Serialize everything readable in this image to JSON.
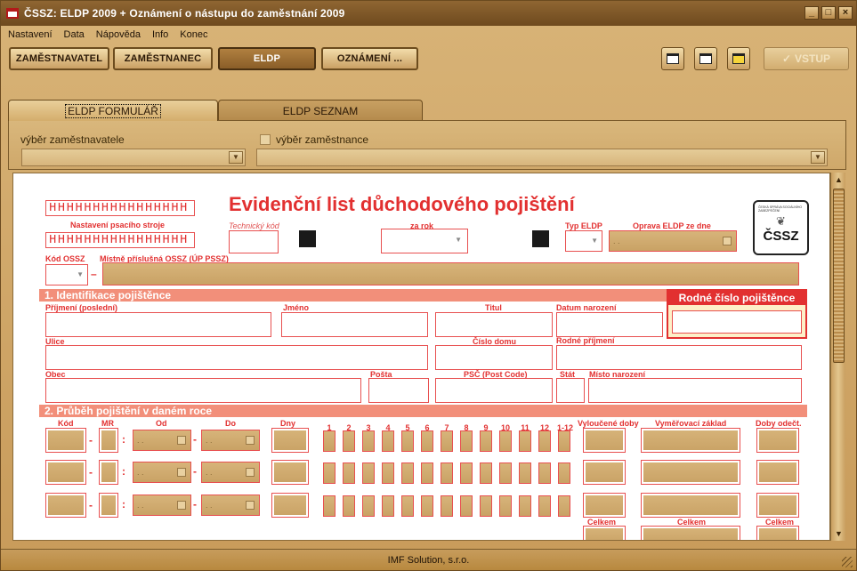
{
  "window": {
    "title": "ČSSZ: ELDP 2009 + Oznámení o nástupu do zaměstnání 2009",
    "minimize": "_",
    "maximize": "□",
    "close": "×"
  },
  "menu": [
    "Nastavení",
    "Data",
    "Nápověda",
    "Info",
    "Konec"
  ],
  "toolbar": {
    "zamestnavatel": "ZAMĚSTNAVATEL",
    "zamestnanec": "ZAMĚSTNANEC",
    "eldp": "ELDP",
    "oznameni": "OZNÁMENÍ ...",
    "vstup": "VSTUP"
  },
  "tabs": {
    "form": "ELDP FORMULÁŘ",
    "list": "ELDP SEZNAM"
  },
  "selectors": {
    "employer_label": "výběr zaměstnavatele",
    "employee_label": "výběr zaměstnance"
  },
  "form": {
    "title": "Evidenční list důchodového pojištění",
    "hatch_text": "HHHHHHHHHHHHHHHH",
    "typewriter_label": "Nastavení psacího stroje",
    "tech_code_label": "Technický kód",
    "year_label": "za rok",
    "eldp_type_label": "Typ ELDP",
    "correction_label": "Oprava ELDP ze dne",
    "date_placeholder": ". .",
    "ossz_code_label": "Kód OSSZ",
    "ossz_local_label": "Místně příslušná OSSZ (ÚP PSSZ)",
    "logo_small": "ČESKÁ SPRÁVA SOCIÁLNÍHO ZABEZPEČENÍ",
    "logo_text": "ČSSZ",
    "section1": "1. Identifikace pojištěnce",
    "birth_number": "Rodné číslo pojištěnce",
    "surname": "Příjmení (poslední)",
    "first_name": "Jméno",
    "degree": "Titul",
    "birth_date": "Datum narození",
    "street": "Ulice",
    "house_no": "Číslo domu",
    "birth_surname": "Rodné příjmení",
    "town": "Obec",
    "post": "Pošta",
    "psc": "PSČ (Post Code)",
    "state": "Stát",
    "birth_place": "Místo narození",
    "section2": "2. Průběh pojištění v daném roce",
    "col_kod": "Kód",
    "col_mr": "MR",
    "col_od": "Od",
    "col_do": "Do",
    "col_dny": "Dny",
    "months": [
      "1",
      "2",
      "3",
      "4",
      "5",
      "6",
      "7",
      "8",
      "9",
      "10",
      "11",
      "12",
      "1-12"
    ],
    "col_excluded": "Vyloučené doby",
    "col_base": "Vyměřovací základ",
    "col_comp": "Doby odečt.",
    "total": "Celkem"
  },
  "status": "IMF Solution, s.r.o."
}
